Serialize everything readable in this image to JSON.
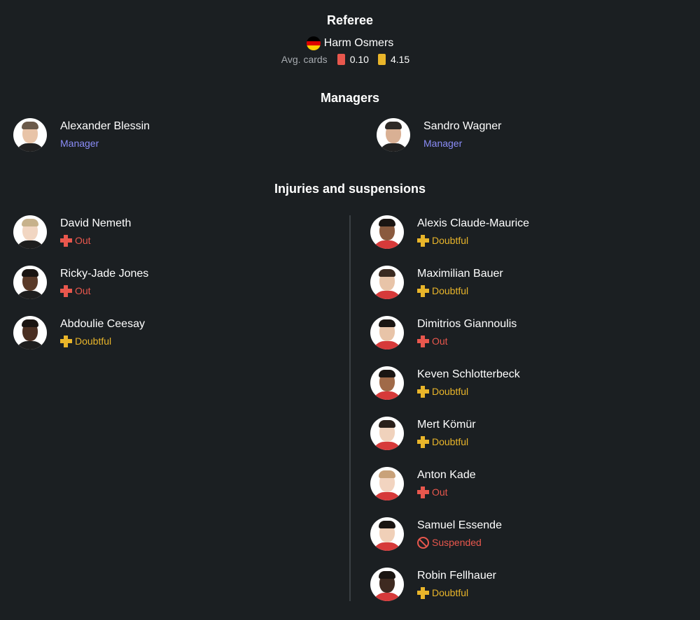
{
  "referee": {
    "title": "Referee",
    "name": "Harm Osmers",
    "avg_cards_label": "Avg. cards",
    "red_avg": "0.10",
    "yellow_avg": "4.15",
    "flag_colors": [
      "#000000",
      "#dd0000",
      "#ffce00"
    ]
  },
  "managers": {
    "title": "Managers",
    "home": {
      "name": "Alexander Blessin",
      "role": "Manager"
    },
    "away": {
      "name": "Sandro Wagner",
      "role": "Manager"
    }
  },
  "injuries": {
    "title": "Injuries and suspensions",
    "home": [
      {
        "name": "David Nemeth",
        "status": "Out",
        "type": "out"
      },
      {
        "name": "Ricky-Jade Jones",
        "status": "Out",
        "type": "out"
      },
      {
        "name": "Abdoulie Ceesay",
        "status": "Doubtful",
        "type": "doubtful"
      }
    ],
    "away": [
      {
        "name": "Alexis Claude-Maurice",
        "status": "Doubtful",
        "type": "doubtful"
      },
      {
        "name": "Maximilian Bauer",
        "status": "Doubtful",
        "type": "doubtful"
      },
      {
        "name": "Dimitrios Giannoulis",
        "status": "Out",
        "type": "out"
      },
      {
        "name": "Keven Schlotterbeck",
        "status": "Doubtful",
        "type": "doubtful"
      },
      {
        "name": "Mert Kömür",
        "status": "Doubtful",
        "type": "doubtful"
      },
      {
        "name": "Anton Kade",
        "status": "Out",
        "type": "out"
      },
      {
        "name": "Samuel Essende",
        "status": "Suspended",
        "type": "suspended"
      },
      {
        "name": "Robin Fellhauer",
        "status": "Doubtful",
        "type": "doubtful"
      }
    ]
  },
  "colors": {
    "background": "#1b1f22",
    "manager": "#8a8cf7",
    "out": "#e8574d",
    "doubtful": "#e9b52a",
    "red_card": "#e8574d",
    "yellow_card": "#e9b52a"
  }
}
